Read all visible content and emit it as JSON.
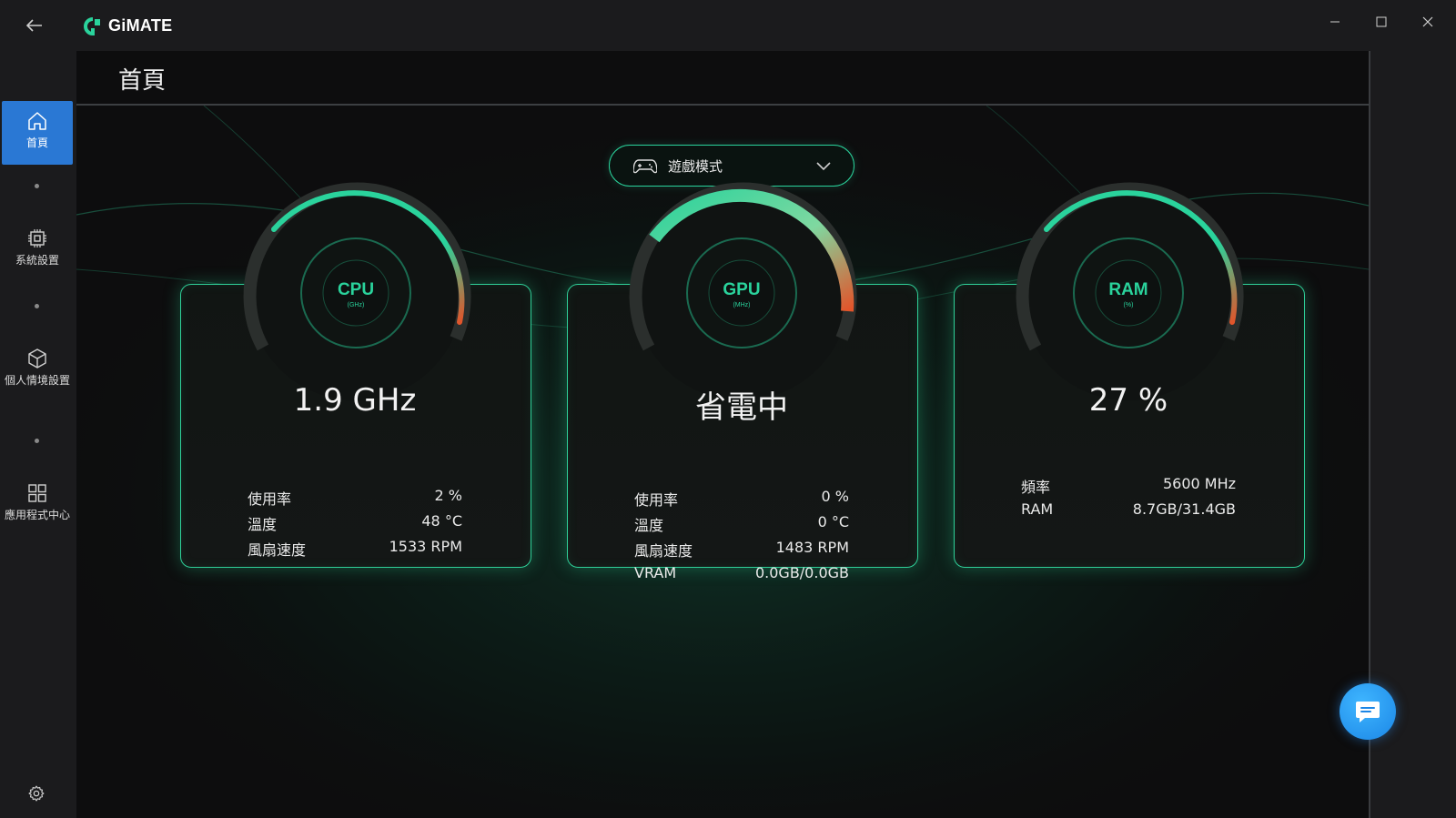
{
  "app": {
    "name": "GiMATE"
  },
  "window_controls": {
    "minimize": "minimize-icon",
    "maximize": "maximize-icon",
    "close": "close-icon"
  },
  "sidebar": {
    "items": [
      {
        "label": "首頁",
        "icon": "home-icon",
        "active": true
      },
      {
        "label": "系統設置",
        "icon": "chip-icon",
        "active": false
      },
      {
        "label": "個人情境設置",
        "icon": "cube-icon",
        "active": false
      },
      {
        "label": "應用程式中心",
        "icon": "grid-icon",
        "active": false
      }
    ],
    "bottom_icon": "gear-icon"
  },
  "page": {
    "title": "首頁"
  },
  "mode_select": {
    "value": "遊戲模式",
    "icon": "gamepad-icon"
  },
  "cards": {
    "cpu": {
      "gauge_label": "CPU",
      "gauge_unit": "(GHz)",
      "headline": "1.9 GHz",
      "rows": [
        {
          "label": "使用率",
          "value": "2 %"
        },
        {
          "label": "溫度",
          "value": "48 °C"
        },
        {
          "label": "風扇速度",
          "value": "1533 RPM"
        }
      ]
    },
    "gpu": {
      "gauge_label": "GPU",
      "gauge_unit": "(MHz)",
      "headline": "省電中",
      "rows": [
        {
          "label": "使用率",
          "value": "0 %"
        },
        {
          "label": "溫度",
          "value": "0 °C"
        },
        {
          "label": "風扇速度",
          "value": "1483 RPM"
        },
        {
          "label": "VRAM",
          "value": "0.0GB/0.0GB"
        }
      ]
    },
    "ram": {
      "gauge_label": "RAM",
      "gauge_unit": "(%)",
      "headline": "27 %",
      "rows": [
        {
          "label": "頻率",
          "value": "5600 MHz"
        },
        {
          "label": "RAM",
          "value": "8.7GB/31.4GB"
        }
      ]
    }
  },
  "colors": {
    "accent": "#2ad39c",
    "active_nav": "#2a78d4",
    "gauge_hot": "#e2542a",
    "chat": "#2a9cf0"
  },
  "chat_button": {
    "icon": "chat-icon"
  }
}
